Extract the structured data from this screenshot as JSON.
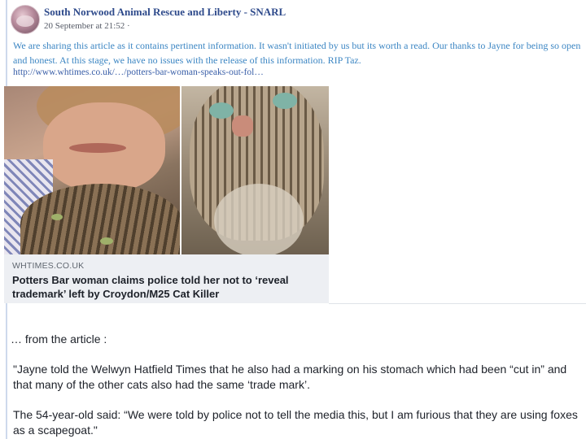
{
  "post": {
    "page_name": "South Norwood Animal Rescue and Liberty - SNARL",
    "timestamp": "20 September at 21:52 ·",
    "text": "We are sharing this article as it contains pertinent information. It wasn't initiated by us but its worth a read. Our thanks to Jayne for being so open and honest. At this stage, we have no issues with the release of this information. RIP Taz.",
    "link_text": "http://www.whtimes.co.uk/…/potters-bar-woman-speaks-out-fol…"
  },
  "preview": {
    "domain": "WHTIMES.CO.UK",
    "headline": "Potters Bar woman claims police told her not to ‘reveal trademark’ left by Croydon/M25 Cat Killer"
  },
  "article": {
    "lead": "… from the article :",
    "quote": "\"Jayne told the Welwyn Hatfield Times that he also had a marking on his stomach which had been “cut in” and that many of the other cats also had the same ‘trade mark’.",
    "quote2": "The 54-year-old said: “We were told by police not to tell the media this, but I am furious that they are using foxes as a scapegoat.\""
  },
  "icons": {
    "avatar": "snarl-avatar-image"
  },
  "colors": {
    "post_text": "#3c86c3",
    "page_name": "#2e4a8b",
    "headline": "#1d2129"
  }
}
